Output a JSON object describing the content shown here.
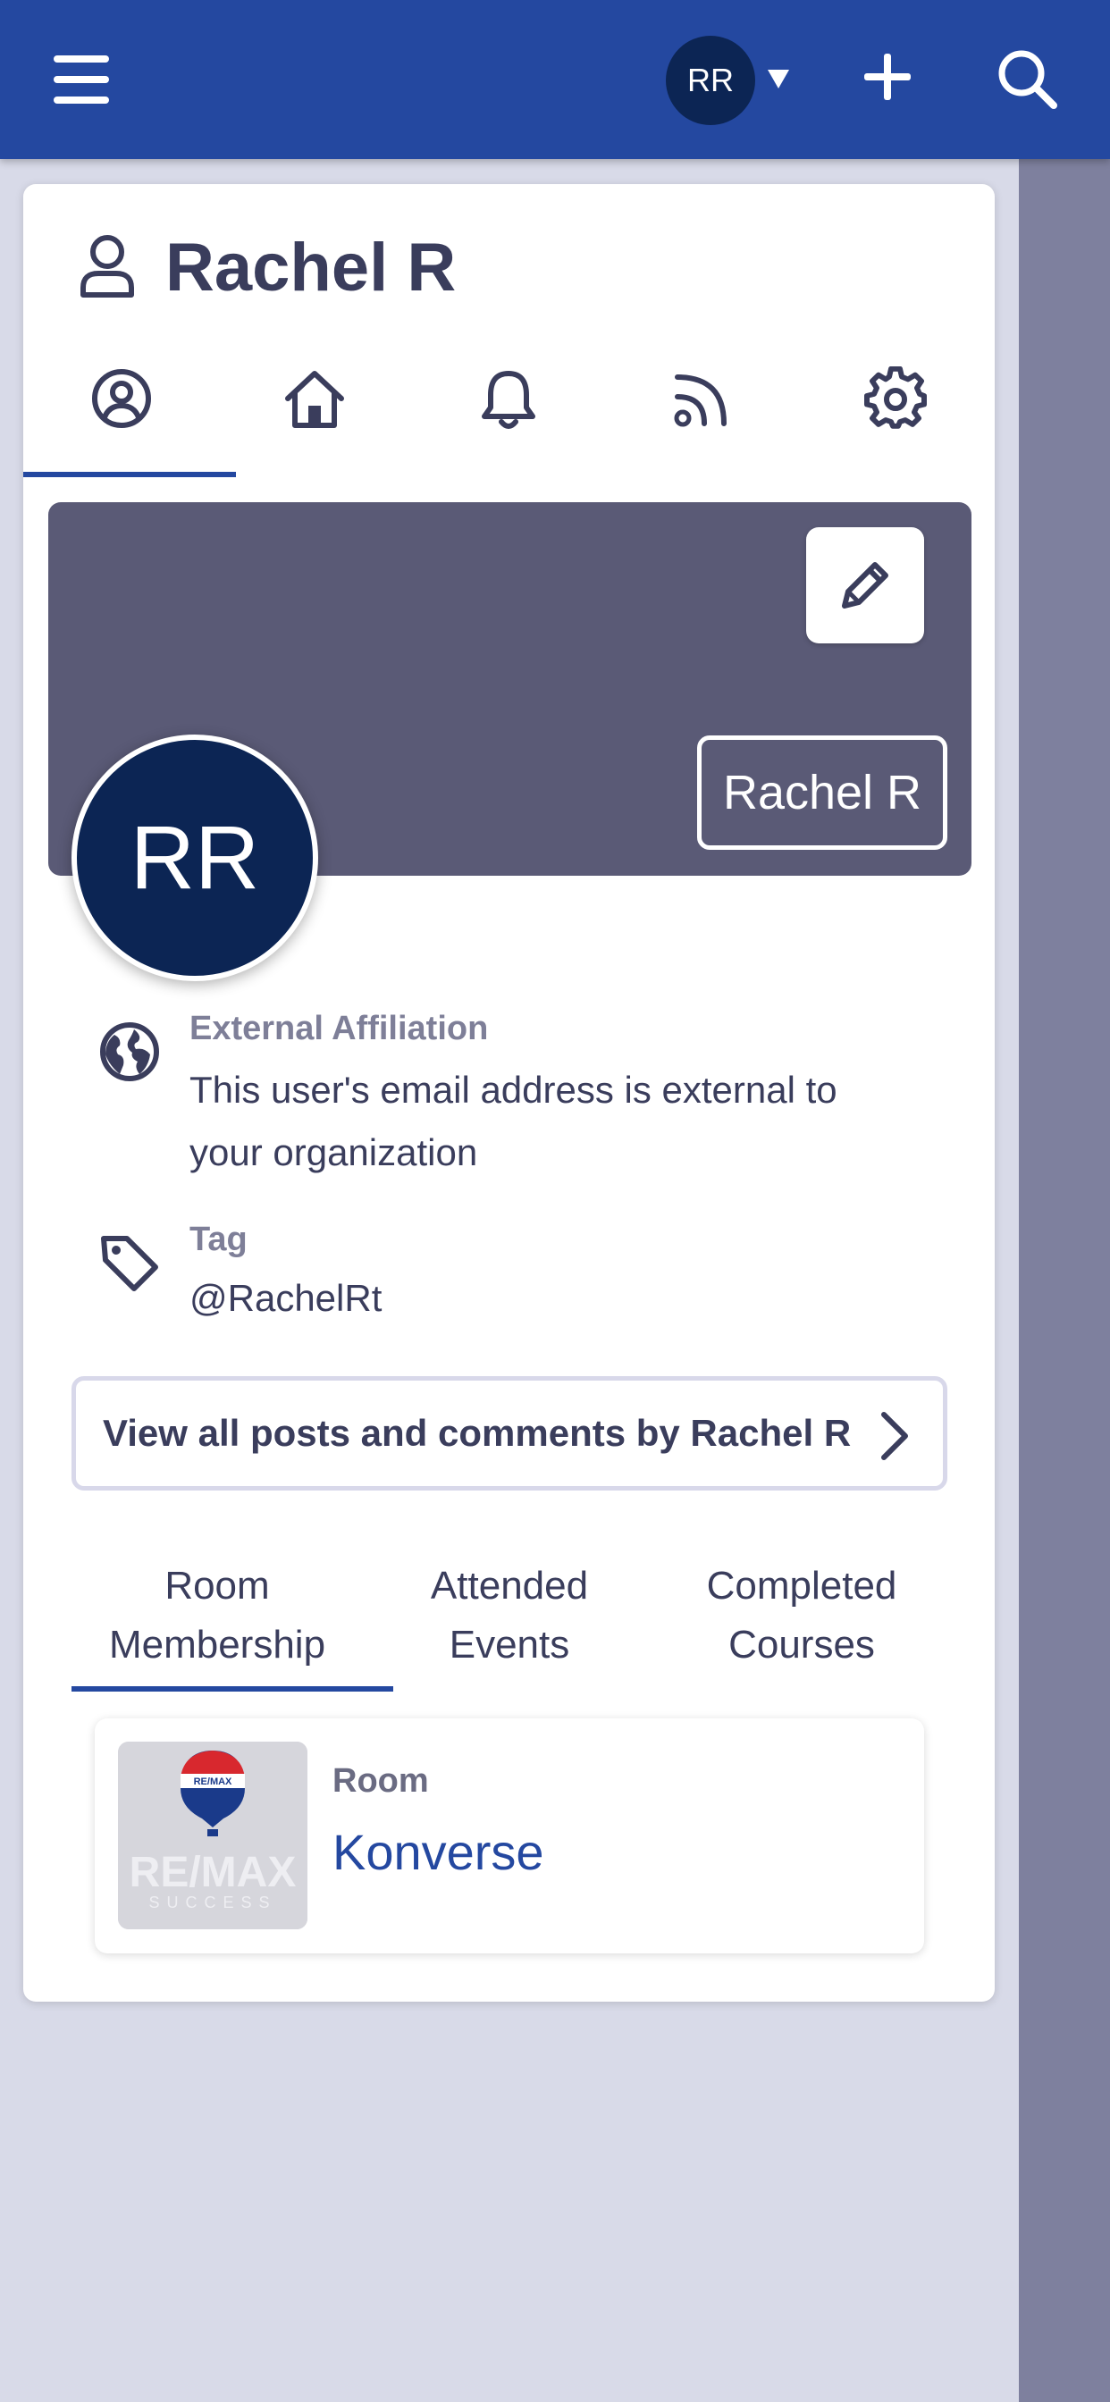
{
  "header": {
    "avatar_initials": "RR",
    "icons": [
      "menu-icon",
      "caret-down-icon",
      "plus-icon",
      "search-icon"
    ],
    "color": "#2448a0"
  },
  "profile": {
    "title": "Rachel R",
    "tabs": [
      "profile-icon",
      "home-icon",
      "bell-icon",
      "rss-icon",
      "gear-icon"
    ],
    "active_tab": 0,
    "banner_name": "Rachel R",
    "avatar_initials": "RR",
    "avatar_color": "#0c2554",
    "banner_color": "#5a5a76"
  },
  "info": {
    "affiliation_label": "External Affiliation",
    "affiliation_line1": "This user's email address is external to",
    "affiliation_line2": "your organization",
    "tag_label": "Tag",
    "tag_value": "@RachelRt"
  },
  "view_posts_label": "View all posts and comments by Rachel R",
  "subtabs": [
    {
      "line1": "Room",
      "line2": "Membership"
    },
    {
      "line1": "Attended",
      "line2": "Events"
    },
    {
      "line1": "Completed",
      "line2": "Courses"
    }
  ],
  "active_subtab": 0,
  "room": {
    "label": "Room",
    "name": "Konverse",
    "logo_brand": "RE/MAX",
    "logo_tagline": "SUCCESS"
  }
}
